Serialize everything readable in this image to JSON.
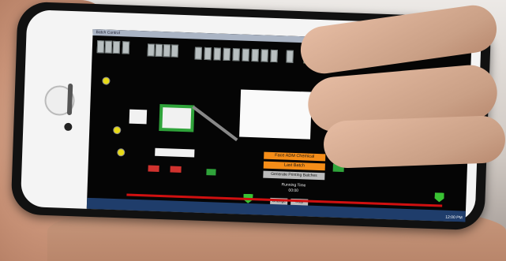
{
  "screen": {
    "title": "Batch Control",
    "buttons": {
      "face_abw": "Face ADM Chemical",
      "last_batch": "Last Batch",
      "generate": "Generate Printing Batches"
    },
    "labels": {
      "running_time_label": "Running Time",
      "running_time_value": "00:00",
      "rcp_label": "RCP",
      "change": "Change",
      "stop": "Stop",
      "start": "Start"
    },
    "taskbar": {
      "clock": "12:00 PM"
    }
  }
}
